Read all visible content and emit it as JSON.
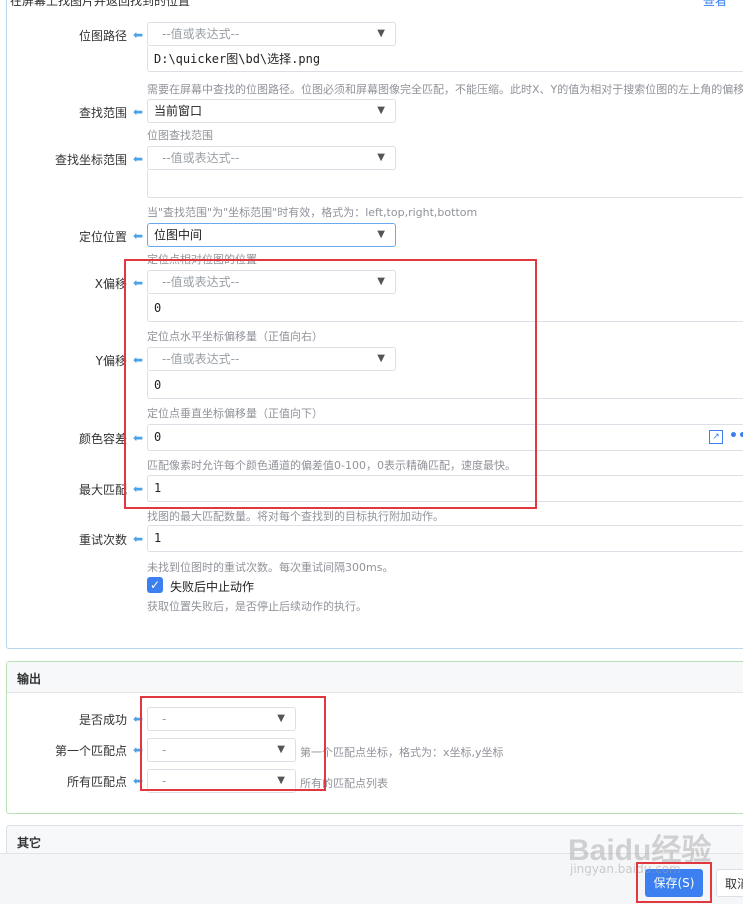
{
  "top_cut_title": "在屏幕上找图片并返回找到的位置",
  "top_right_link": "查看",
  "fields": {
    "bitmap_path": {
      "label": "位图路径",
      "select": "--值或表达式--",
      "value": "D:\\quicker图\\bd\\选择.png",
      "hint": "需要在屏幕中查找的位图路径。位图必须和屏幕图像完全匹配，不能压缩。此时X、Y的值为相对于搜索位图的左上角的偏移"
    },
    "search_range": {
      "label": "查找范围",
      "select": "当前窗口",
      "hint": "位图查找范围"
    },
    "search_coord_range": {
      "label": "查找坐标范围",
      "select": "--值或表达式--",
      "value": "",
      "hint": "当\"查找范围\"为\"坐标范围\"时有效，格式为：left,top,right,bottom"
    },
    "locate_position": {
      "label": "定位位置",
      "select": "位图中间",
      "hint": "定位点相对位图的位置"
    },
    "x_offset": {
      "label": "X偏移",
      "select": "--值或表达式--",
      "value": "0",
      "hint": "定位点水平坐标偏移量（正值向右）"
    },
    "y_offset": {
      "label": "Y偏移",
      "select": "--值或表达式--",
      "value": "0",
      "hint": "定位点垂直坐标偏移量（正值向下）"
    },
    "color_tolerance": {
      "label": "颜色容差",
      "value": "0",
      "hint": "匹配像素时允许每个颜色通道的偏差值0-100，0表示精确匹配，速度最快。"
    },
    "max_matches": {
      "label": "最大匹配",
      "value": "1",
      "hint": "找图的最大匹配数量。将对每个查找到的目标执行附加动作。"
    },
    "retry_count": {
      "label": "重试次数",
      "value": "1",
      "hint": "未找到位图时的重试次数。每次重试间隔300ms。"
    },
    "abort_on_fail": {
      "label": "失败后中止动作",
      "checked": true,
      "hint": "获取位置失败后，是否停止后续动作的执行。"
    }
  },
  "output_section": {
    "title": "输出",
    "rows": [
      {
        "label": "是否成功",
        "select": "-",
        "hint": ""
      },
      {
        "label": "第一个匹配点",
        "select": "-",
        "hint": "第一个匹配点坐标，格式为：x坐标,y坐标"
      },
      {
        "label": "所有匹配点",
        "select": "-",
        "hint": "所有的匹配点列表"
      }
    ]
  },
  "other_section": {
    "title": "其它"
  },
  "footer": {
    "save_label": "保存(S)",
    "cancel_label": "取消"
  },
  "watermark": {
    "line1": "Baidu经验",
    "line2": "jingyan.baidu.com"
  },
  "colors": {
    "accent": "#3b7ff0",
    "annotation_red": "#e0383e",
    "section_border": "#b9e0b4"
  }
}
